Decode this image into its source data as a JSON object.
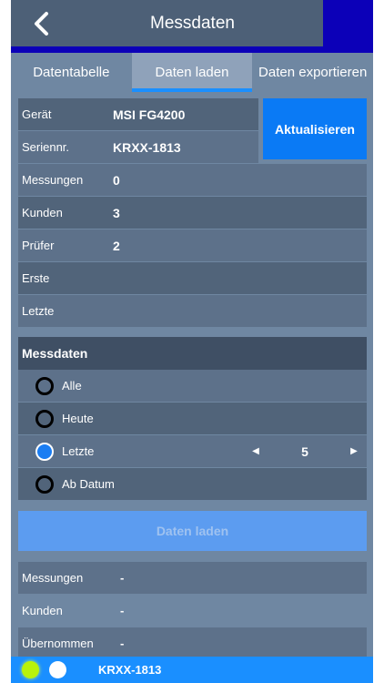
{
  "header": {
    "title": "Messdaten"
  },
  "tabs": [
    {
      "label": "Datentabelle"
    },
    {
      "label": "Daten laden"
    },
    {
      "label": "Daten exportieren"
    }
  ],
  "device": {
    "rows": [
      {
        "label": "Gerät",
        "value": "MSI FG4200"
      },
      {
        "label": "Seriennr.",
        "value": "KRXX-1813"
      },
      {
        "label": "Messungen",
        "value": "0"
      },
      {
        "label": "Kunden",
        "value": "3"
      },
      {
        "label": "Prüfer",
        "value": "2"
      },
      {
        "label": "Erste",
        "value": ""
      },
      {
        "label": "Letzte",
        "value": ""
      }
    ],
    "refresh_label": "Aktualisieren"
  },
  "messdaten": {
    "title": "Messdaten",
    "options": [
      {
        "label": "Alle",
        "selected": false
      },
      {
        "label": "Heute",
        "selected": false
      },
      {
        "label": "Letzte",
        "selected": true
      },
      {
        "label": "Ab Datum",
        "selected": false
      }
    ],
    "stepper_value": "5"
  },
  "load_button_label": "Daten laden",
  "stats": [
    {
      "label": "Messungen",
      "value": "-"
    },
    {
      "label": "Kunden",
      "value": "-"
    },
    {
      "label": "Übernommen",
      "value": "-"
    }
  ],
  "footer": {
    "device": "KRXX-1813"
  },
  "colors": {
    "accent": "#1a8fff",
    "header": "#0c00b8",
    "led_green": "#b9f20a"
  }
}
